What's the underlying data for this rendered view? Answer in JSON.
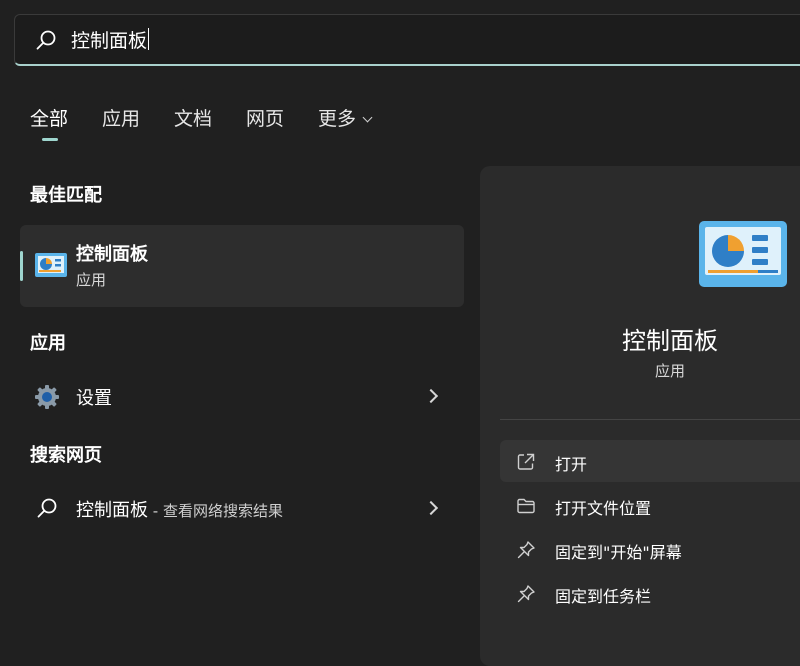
{
  "search": {
    "query": "控制面板"
  },
  "tabs": [
    {
      "label": "全部"
    },
    {
      "label": "应用"
    },
    {
      "label": "文档"
    },
    {
      "label": "网页"
    },
    {
      "label": "更多"
    }
  ],
  "left": {
    "best_match": {
      "heading": "最佳匹配",
      "title": "控制面板",
      "subtitle": "应用"
    },
    "apps": {
      "heading": "应用",
      "items": [
        {
          "label": "设置"
        }
      ]
    },
    "web": {
      "heading": "搜索网页",
      "items": [
        {
          "label": "控制面板",
          "suffix": " - 查看网络搜索结果"
        }
      ]
    }
  },
  "detail": {
    "title": "控制面板",
    "subtitle": "应用",
    "actions": [
      {
        "label": "打开",
        "icon": "open-external-icon"
      },
      {
        "label": "打开文件位置",
        "icon": "folder-icon"
      },
      {
        "label": "固定到\"开始\"屏幕",
        "icon": "pin-icon"
      },
      {
        "label": "固定到任务栏",
        "icon": "pin-icon"
      }
    ]
  },
  "colors": {
    "accent": "#9fd6cf",
    "background": "#202020",
    "panel": "#2b2b2b",
    "card": "#2d2d2d"
  }
}
